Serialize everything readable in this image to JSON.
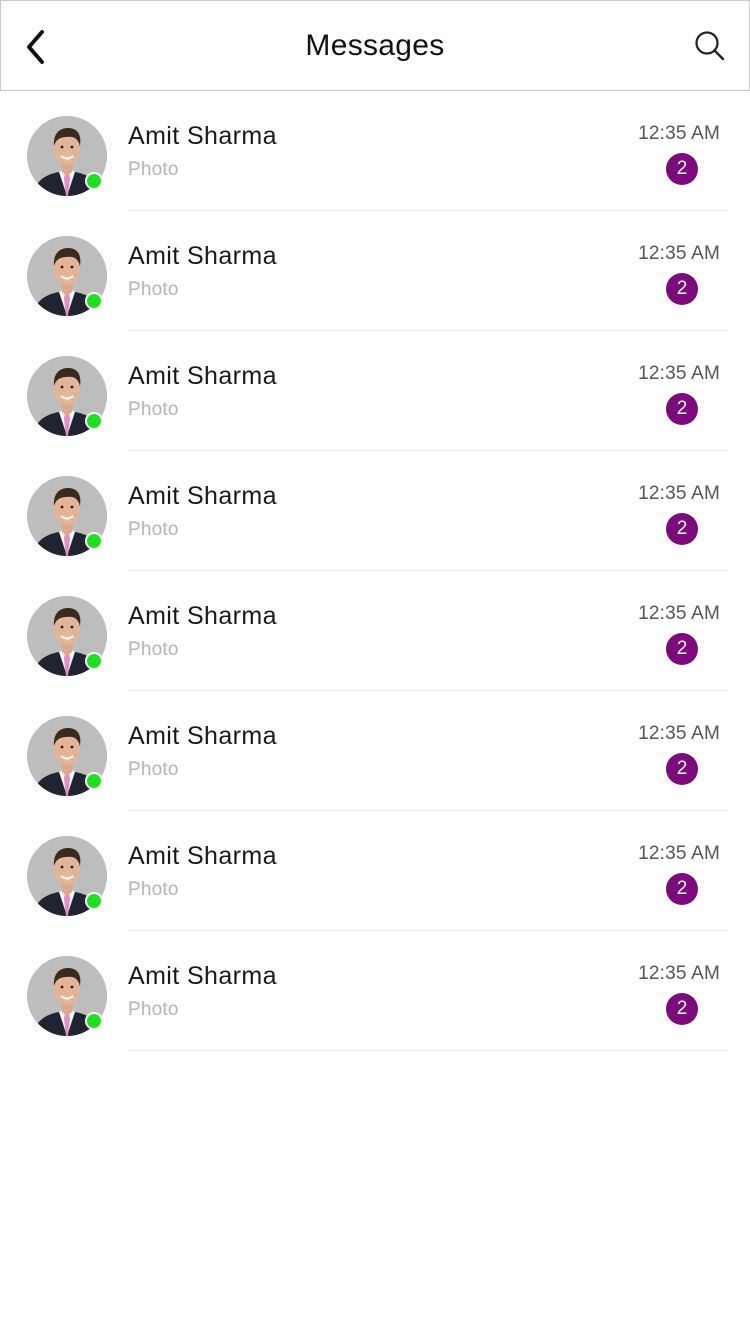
{
  "header": {
    "title": "Messages",
    "back_icon": "chevron-left-icon",
    "search_icon": "search-icon"
  },
  "colors": {
    "badge": "#7d0a7d",
    "online": "#1fe01f",
    "divider": "#e6e6e6"
  },
  "conversations": [
    {
      "name": "Amit Sharma",
      "preview": "Photo",
      "time": "12:35 AM",
      "unread": "2",
      "online": true
    },
    {
      "name": "Amit Sharma",
      "preview": "Photo",
      "time": "12:35 AM",
      "unread": "2",
      "online": true
    },
    {
      "name": "Amit Sharma",
      "preview": "Photo",
      "time": "12:35 AM",
      "unread": "2",
      "online": true
    },
    {
      "name": "Amit Sharma",
      "preview": "Photo",
      "time": "12:35 AM",
      "unread": "2",
      "online": true
    },
    {
      "name": "Amit Sharma",
      "preview": "Photo",
      "time": "12:35 AM",
      "unread": "2",
      "online": true
    },
    {
      "name": "Amit Sharma",
      "preview": "Photo",
      "time": "12:35 AM",
      "unread": "2",
      "online": true
    },
    {
      "name": "Amit Sharma",
      "preview": "Photo",
      "time": "12:35 AM",
      "unread": "2",
      "online": true
    },
    {
      "name": "Amit Sharma",
      "preview": "Photo",
      "time": "12:35 AM",
      "unread": "2",
      "online": true
    }
  ]
}
